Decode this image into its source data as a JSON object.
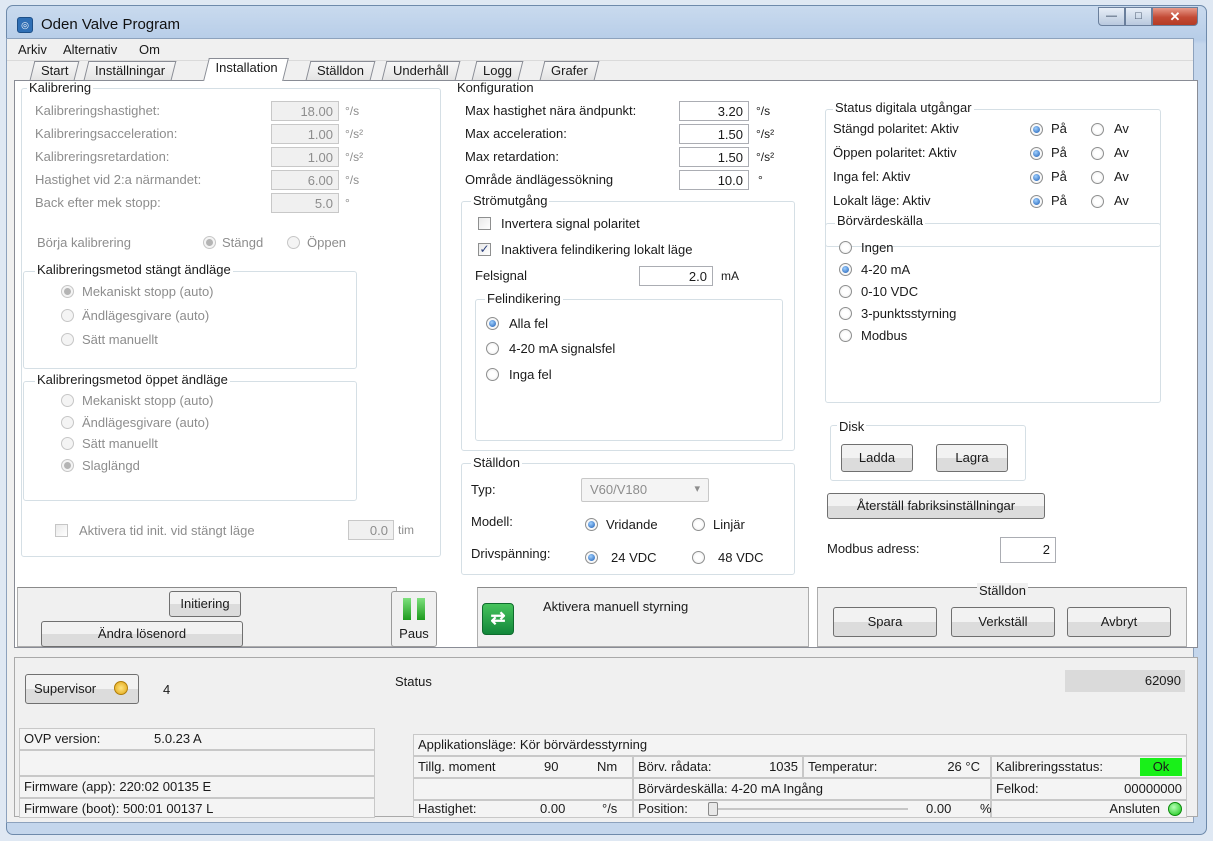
{
  "window": {
    "title": "Oden Valve Program",
    "minimize": "—",
    "maximize": "□",
    "close": "✕"
  },
  "menu": [
    "Arkiv",
    "Alternativ",
    "Om"
  ],
  "tabs": [
    "Start",
    "Inställningar",
    "Installation",
    "Ställdon",
    "Underhåll",
    "Logg",
    "Grafer"
  ],
  "kalibrering": {
    "title": "Kalibrering",
    "rows": [
      {
        "label": "Kalibreringshastighet:",
        "value": "18.00",
        "unit": "°/s"
      },
      {
        "label": "Kalibreringsacceleration:",
        "value": "1.00",
        "unit": "°/s²"
      },
      {
        "label": "Kalibreringsretardation:",
        "value": "1.00",
        "unit": "°/s²"
      },
      {
        "label": "Hastighet vid 2:a närmandet:",
        "value": "6.00",
        "unit": "°/s"
      },
      {
        "label": "Back efter mek stopp:",
        "value": "5.0",
        "unit": "°"
      }
    ],
    "borja": "Börja kalibrering",
    "stangd": "Stängd",
    "oppen": "Öppen",
    "stangt_title": "Kalibreringsmetod stängt ändläge",
    "stangt": [
      "Mekaniskt stopp (auto)",
      "Ändlägesgivare (auto)",
      "Sätt manuellt"
    ],
    "oppet_title": "Kalibreringsmetod öppet ändläge",
    "oppet": [
      "Mekaniskt stopp (auto)",
      "Ändlägesgivare (auto)",
      "Sätt manuellt",
      "Slaglängd"
    ],
    "aktivera": "Aktivera tid init. vid stängt läge",
    "tid_value": "0.0",
    "tid_unit": "tim"
  },
  "konfig": {
    "title": "Konfiguration",
    "rows": [
      {
        "label": "Max hastighet nära ändpunkt:",
        "value": "3.20",
        "unit": "°/s"
      },
      {
        "label": "Max acceleration:",
        "value": "1.50",
        "unit": "°/s²"
      },
      {
        "label": "Max retardation:",
        "value": "1.50",
        "unit": "°/s²"
      },
      {
        "label": "Område ändlägessökning",
        "value": "10.0",
        "unit": "°"
      }
    ],
    "strom_title": "Strömutgång",
    "invertera": "Invertera signal polaritet",
    "inaktivera": "Inaktivera felindikering lokalt läge",
    "check_mark": "✓",
    "felsignal": "Felsignal",
    "felsignal_value": "2.0",
    "felsignal_unit": "mA",
    "felind_title": "Felindikering",
    "felind": [
      "Alla fel",
      "4-20 mA signalsfel",
      "Inga fel"
    ],
    "stalldon_title": "Ställdon",
    "typ": "Typ:",
    "typ_value": "V60/V180",
    "dropdown_arrow": "▾",
    "modell": "Modell:",
    "vridande": "Vridande",
    "linjar": "Linjär",
    "driv": "Drivspänning:",
    "v24": "24 VDC",
    "v48": "48 VDC"
  },
  "status_dig": {
    "title": "Status digitala utgångar",
    "rows": [
      "Stängd polaritet: Aktiv",
      "Öppen polaritet: Aktiv",
      "Inga fel: Aktiv",
      "Lokalt läge: Aktiv"
    ],
    "pa": "På",
    "av": "Av"
  },
  "borvarde": {
    "title": "Börvärdeskälla",
    "options": [
      "Ingen",
      "4-20 mA",
      "0-10 VDC",
      "3-punktsstyrning",
      "Modbus"
    ]
  },
  "disk": {
    "title": "Disk",
    "ladda": "Ladda",
    "lagra": "Lagra"
  },
  "aterstall": "Återställ fabriksinställningar",
  "modbus": {
    "label": "Modbus adress:",
    "value": "2"
  },
  "actions": {
    "initiering": "Initiering",
    "andra": "Ändra lösenord",
    "paus": "Paus",
    "manuell": "Aktivera manuell styrning",
    "stalldon": "Ställdon",
    "spara": "Spara",
    "verkstall": "Verkställ",
    "avbryt": "Avbryt"
  },
  "info": {
    "supervisor": "Supervisor",
    "level": "4",
    "ovp_label": "OVP version:",
    "ovp_value": "5.0.23 A",
    "fw_app": "Firmware (app):  220:02 00135 E",
    "fw_boot": "Firmware (boot):  500:01 00137 L"
  },
  "status": {
    "title": "Status",
    "code": "62090",
    "applage": "Applikationsläge:  Kör börvärdesstyrning",
    "tillg": "Tillg. moment",
    "tillg_val": "90",
    "tillg_unit": "Nm",
    "borv_radata": "Börv. rådata:",
    "borv_radata_val": "1035",
    "temp": "Temperatur:",
    "temp_val": "26 °C",
    "kal_status": "Kalibreringsstatus:",
    "kal_ok": "Ok",
    "borv_kalla": "Börvärdeskälla:  4-20 mA Ingång",
    "felkod": "Felkod:",
    "felkod_val": "00000000",
    "hastighet": "Hastighet:",
    "hast_val": "0.00",
    "hast_unit": "°/s",
    "position": "Position:",
    "pos_val": "0.00",
    "pos_unit": "%",
    "ansluten": "Ansluten"
  }
}
